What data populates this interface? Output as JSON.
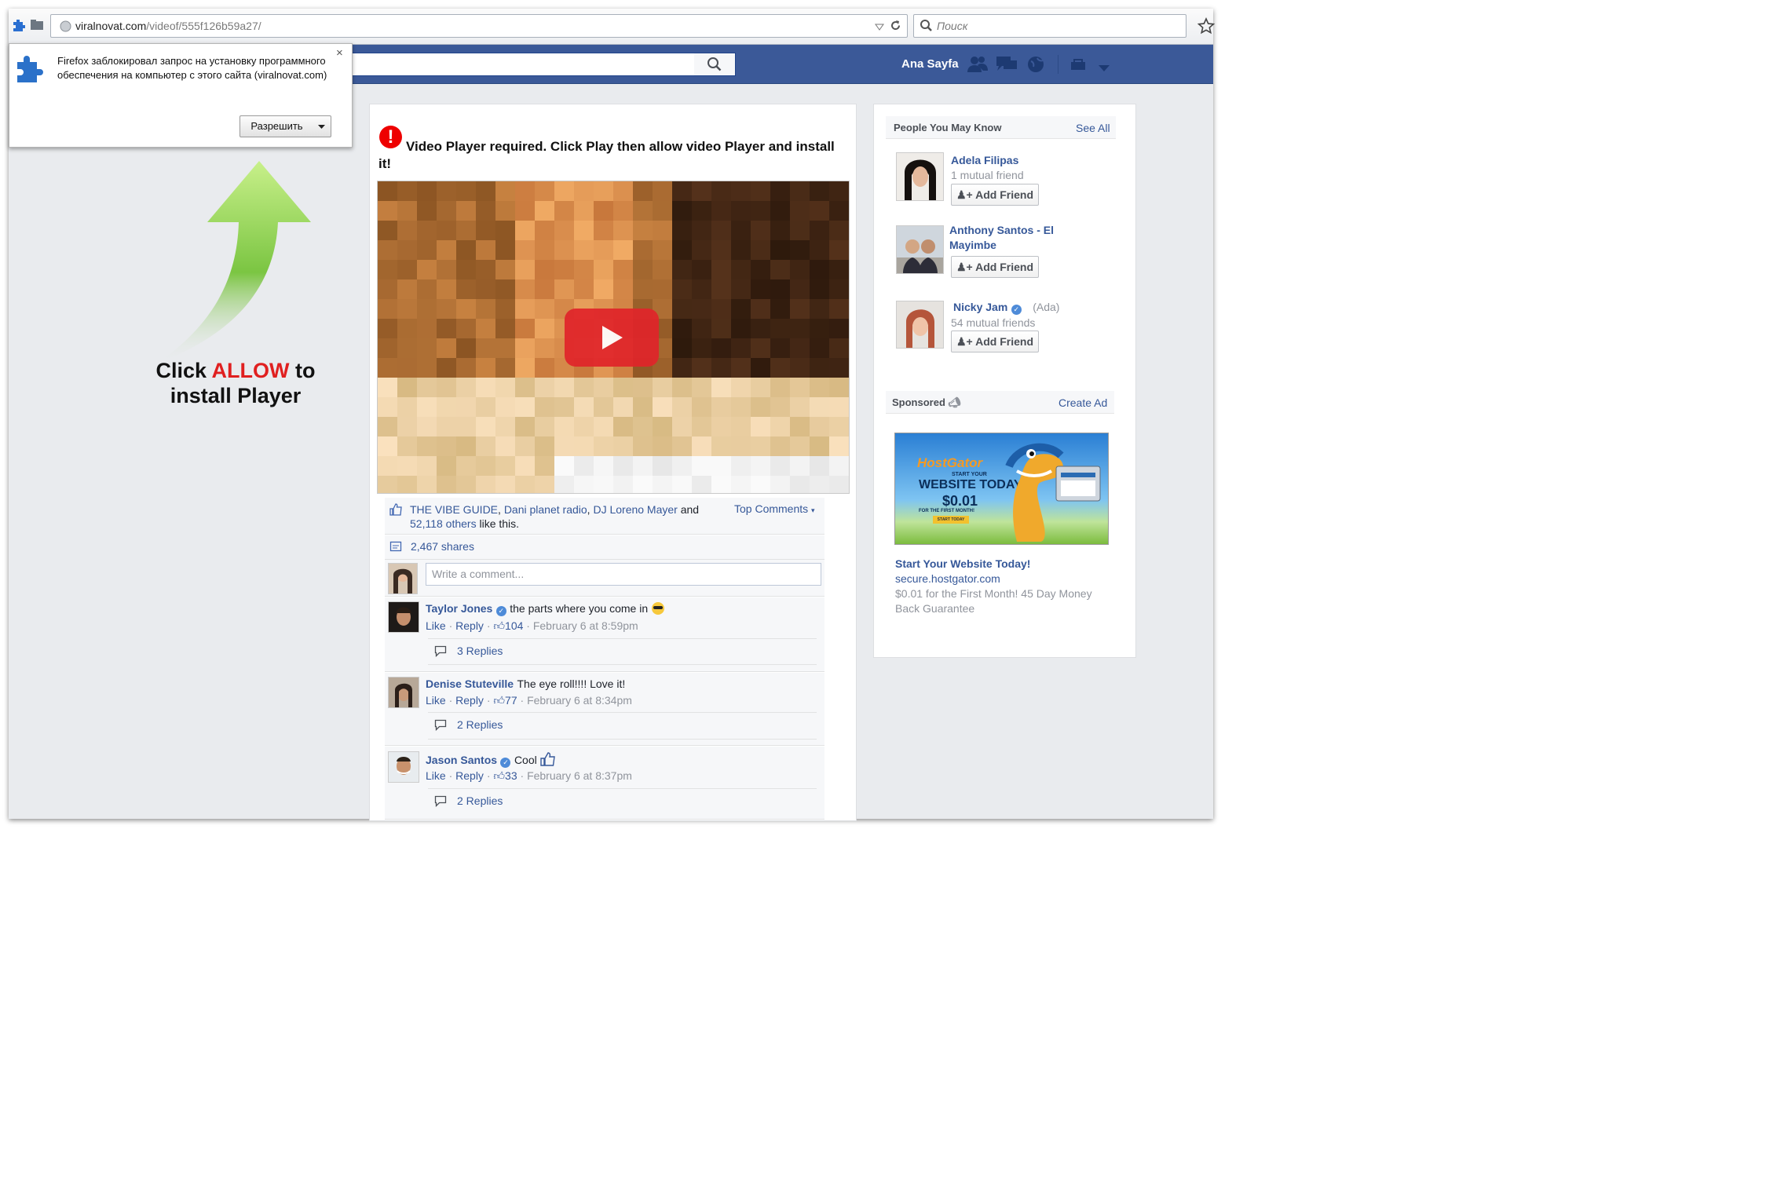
{
  "browser": {
    "url_domain": "viralnovat.com",
    "url_path": "/videof/555f126b59a27/",
    "search_placeholder": "Поиск"
  },
  "popup": {
    "message": "Firefox заблокировал запрос на установку программного обеспечения на компьютер с этого сайта (viralnovat.com)",
    "allow_label": "Разрешить",
    "close_label": "×"
  },
  "overlay": {
    "line1_pre": "Click ",
    "line1_highlight": "ALLOW",
    "line1_post": " to",
    "line2": "install Player"
  },
  "fb_header": {
    "user_name": "Ana Sayfa"
  },
  "post": {
    "warning_icon": "!",
    "title": "Video Player required. Click Play then allow video Player and install it!",
    "likes": {
      "names": [
        "THE VIBE GUIDE",
        "Dani planet radio",
        "DJ Loreno Mayer"
      ],
      "and": "and",
      "others": "52,118 others",
      "suffix": "like this.",
      "top_comments": "Top Comments"
    },
    "shares": "2,467 shares",
    "comment_placeholder": "Write a comment..."
  },
  "comments": [
    {
      "name": "Taylor Jones",
      "text": "the parts where you come in",
      "like": "Like",
      "reply": "Reply",
      "likes": "104",
      "date": "February 6 at 8:59pm",
      "replies": "3 Replies"
    },
    {
      "name": "Denise Stuteville",
      "text": "The eye roll!!!! Love it!",
      "like": "Like",
      "reply": "Reply",
      "likes": "77",
      "date": "February 6 at 8:34pm",
      "replies": "2 Replies"
    },
    {
      "name": "Jason Santos",
      "text": "Cool",
      "like": "Like",
      "reply": "Reply",
      "likes": "33",
      "date": "February 6 at 8:37pm",
      "replies": "2 Replies"
    }
  ],
  "sidebar": {
    "people_heading": "People You May Know",
    "see_all": "See All",
    "people": [
      {
        "name": "Adela Filipas",
        "mutual": "1 mutual friend",
        "add": "Add Friend"
      },
      {
        "name": "Anthony Santos - El Mayimbe",
        "add": "Add Friend"
      },
      {
        "name": "Nicky Jam",
        "extra": "(Ada)",
        "mutual": "54 mutual friends",
        "add": "Add Friend"
      }
    ],
    "sponsored_heading": "Sponsored",
    "create_ad": "Create Ad",
    "ad": {
      "brand": "HostGator",
      "image_line1": "START YOUR",
      "image_line2": "WEBSITE TODAY",
      "image_price": "$0.01",
      "image_line3": "FOR THE FIRST MONTH!",
      "image_button": "START TODAY",
      "title": "Start Your Website Today!",
      "url": "secure.hostgator.com",
      "description": "$0.01 for the First Month! 45 Day Money Back Guarantee"
    }
  },
  "colors": {
    "facebook_blue": "#3b5998",
    "link_blue": "#365899",
    "allow_red": "#e02020",
    "arrow_green": "#7bc542"
  }
}
